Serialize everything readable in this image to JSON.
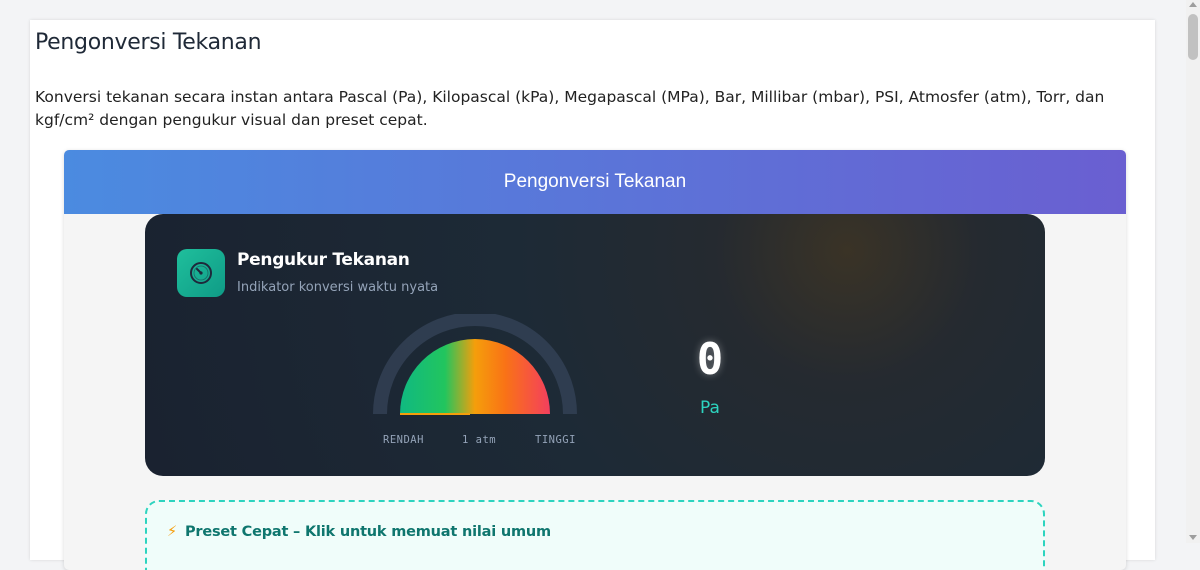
{
  "page": {
    "title": "Pengonversi Tekanan",
    "description": "Konversi tekanan secara instan antara Pascal (Pa), Kilopascal (kPa), Megapascal (MPa), Bar, Millibar (mbar), PSI, Atmosfer (atm), Torr, dan kgf/cm² dengan pengukur visual dan preset cepat."
  },
  "card": {
    "header_title": "Pengonversi Tekanan"
  },
  "gauge": {
    "icon": "gauge-icon",
    "title": "Pengukur Tekanan",
    "subtitle": "Indikator konversi waktu nyata",
    "scale_low": "RENDAH",
    "scale_mid": "1 atm",
    "scale_high": "TINGGI",
    "value": "0",
    "unit": "Pa",
    "level": 0
  },
  "presets": {
    "icon": "lightning-icon",
    "title": "Preset Cepat – Klik untuk memuat nilai umum"
  },
  "colors": {
    "header_start": "#4b8be0",
    "header_end": "#6a5fd1",
    "accent": "#2dd4bf",
    "gauge_low": "#10b981",
    "gauge_mid": "#f59e0b",
    "gauge_high": "#f43f5e"
  }
}
